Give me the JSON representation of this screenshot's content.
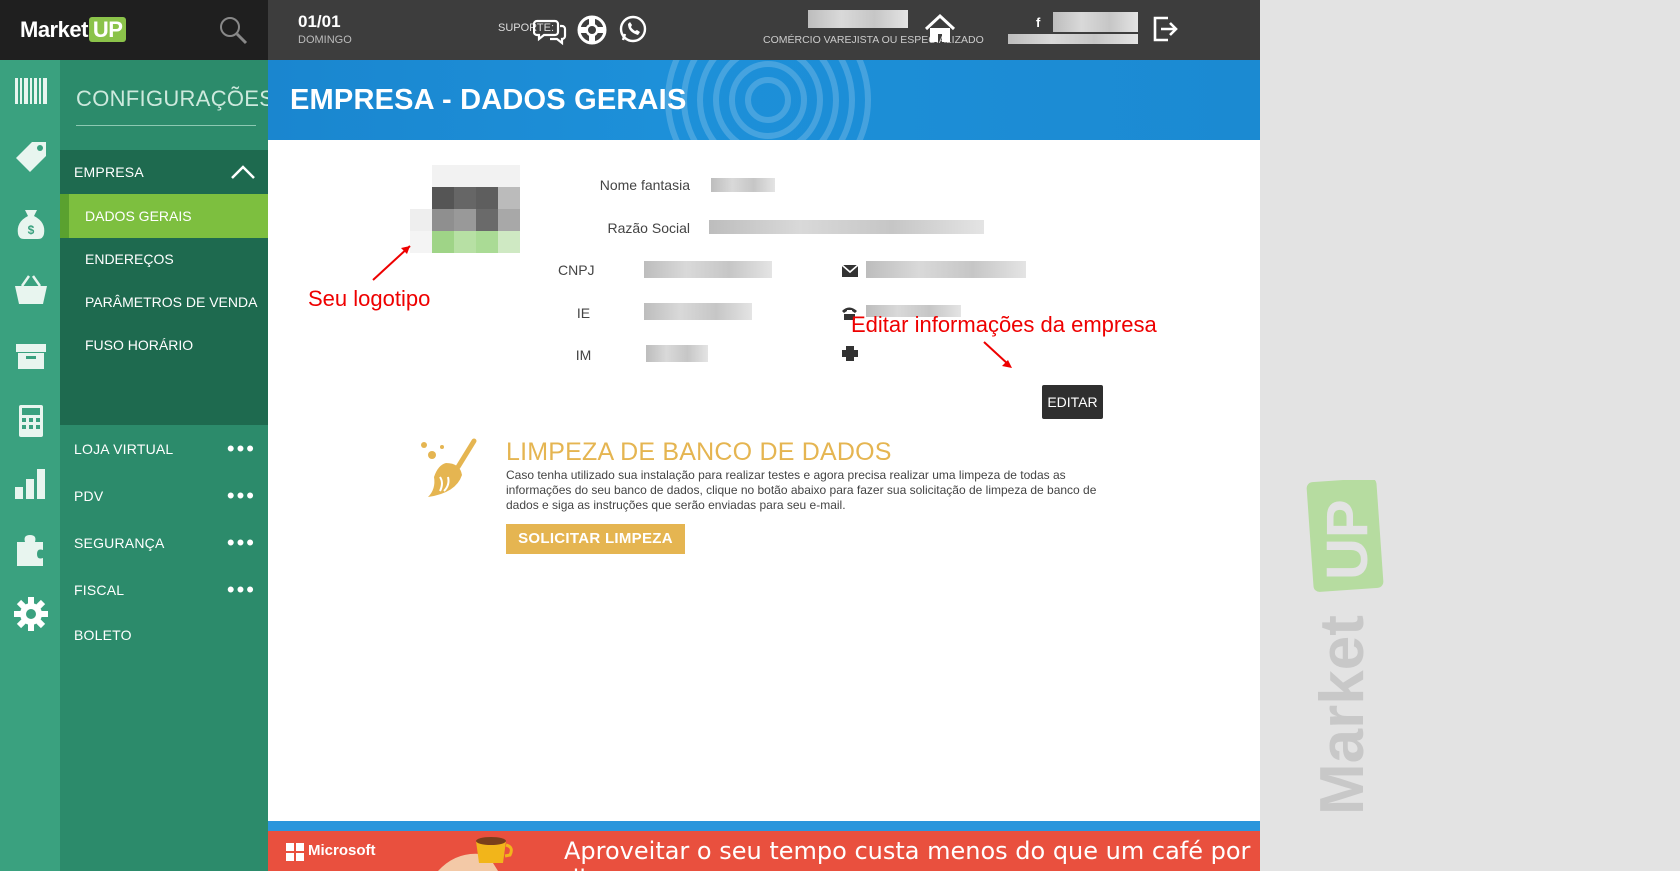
{
  "brand": {
    "name_part1": "Market",
    "name_part2": "UP"
  },
  "topbar": {
    "date": "01/01",
    "weekday": "DOMINGO",
    "suporte_label": "SUPORTE:",
    "segment": "COMÉRCIO VAREJISTA OU ESPECIALIZADO",
    "facebook_glyph": "f"
  },
  "sidebar": {
    "title": "CONFIGURAÇÕES",
    "empresa_label": "EMPRESA",
    "empresa_subitems": [
      {
        "label": "DADOS GERAIS",
        "active": true
      },
      {
        "label": "ENDEREÇOS",
        "active": false
      },
      {
        "label": "PARÂMETROS DE VENDA",
        "active": false
      },
      {
        "label": "FUSO HORÁRIO",
        "active": false
      }
    ],
    "items": [
      {
        "label": "LOJA VIRTUAL"
      },
      {
        "label": "PDV"
      },
      {
        "label": "SEGURANÇA"
      },
      {
        "label": "FISCAL"
      },
      {
        "label": "BOLETO"
      }
    ]
  },
  "page": {
    "title": "EMPRESA - DADOS GERAIS",
    "fields": {
      "nome_fantasia": "Nome fantasia",
      "razao_social": "Razão Social",
      "cnpj": "CNPJ",
      "ie": "IE",
      "im": "IM"
    },
    "annotations": {
      "logo": "Seu logotipo",
      "edit": "Editar informações da empresa"
    },
    "editar_label": "EDITAR",
    "limpeza": {
      "title": "LIMPEZA DE BANCO DE DADOS",
      "text": "Caso tenha utilizado sua instalação para realizar testes e agora precisa realizar uma limpeza de todas as informações do seu banco de dados, clique no botão abaixo para fazer sua solicitação de limpeza de banco de dados e siga as instruções que serão enviadas para seu e-mail.",
      "button": "SOLICITAR LIMPEZA"
    }
  },
  "banner": {
    "brand": "Microsoft",
    "text": "Aproveitar o seu tempo custa menos do que um café por dia."
  },
  "watermark": {
    "text": "MarketUP"
  },
  "colors": {
    "topbar": "#3d3d3d",
    "rail": "#3aa17f",
    "sidebar": "#2c8b6b",
    "active": "#7dbf3f",
    "header": "#1d90d9",
    "accent_gold": "#e5b551",
    "annotation": "#ee0000",
    "banner": "#e9503e"
  }
}
